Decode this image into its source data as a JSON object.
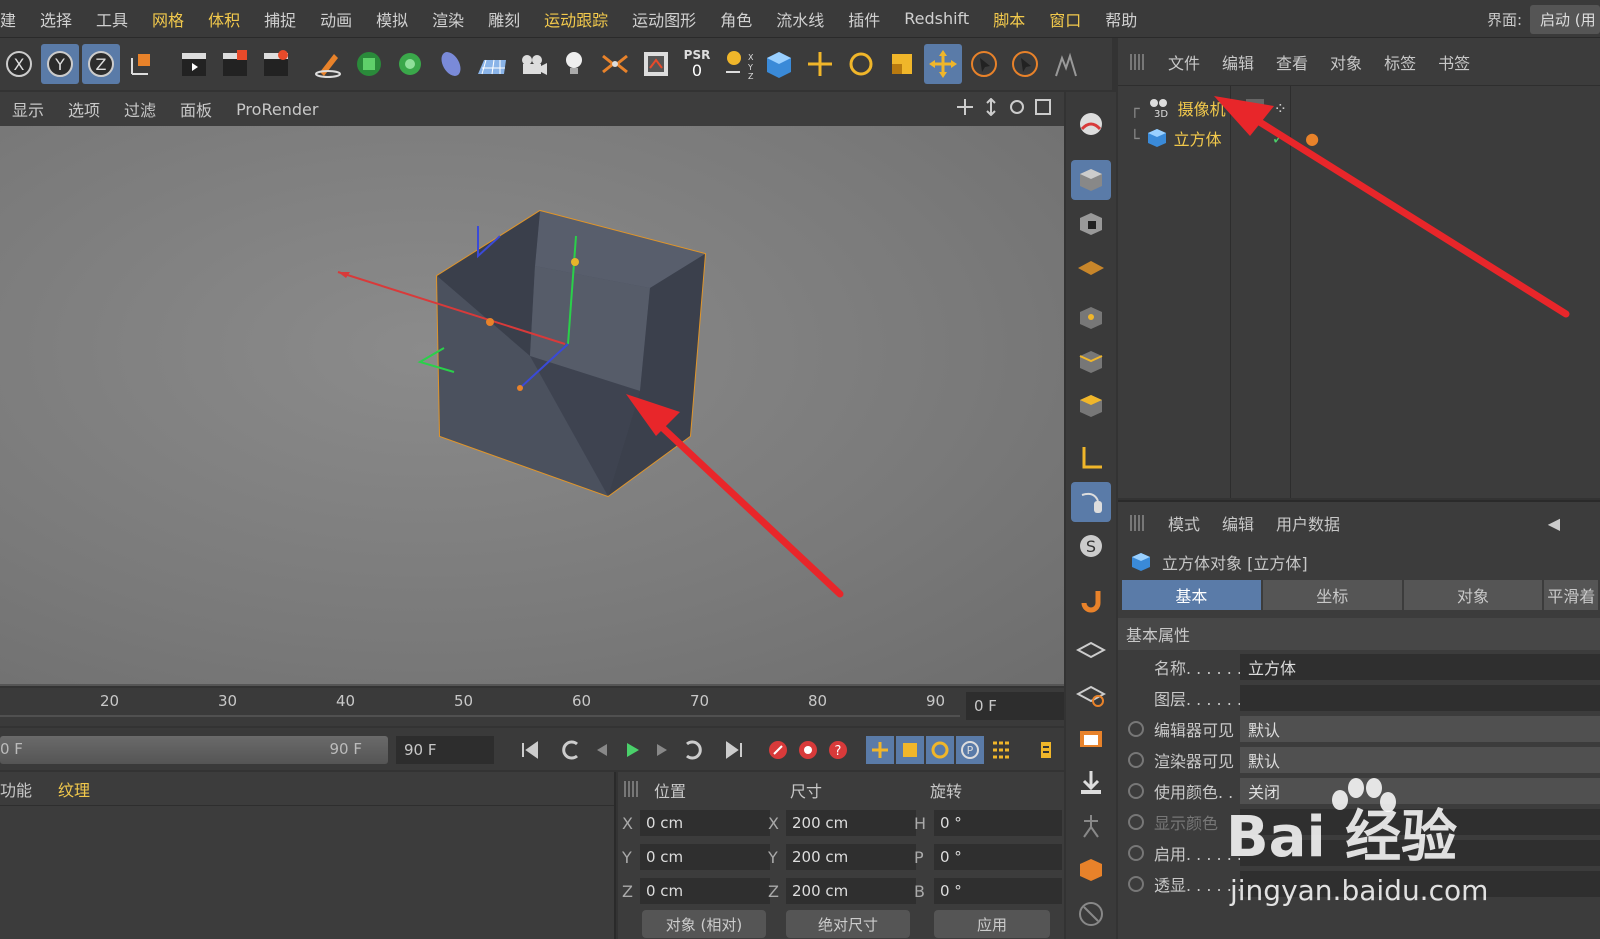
{
  "menubar": {
    "items": [
      {
        "label": "建",
        "hl": false
      },
      {
        "label": "选择",
        "hl": false
      },
      {
        "label": "工具",
        "hl": false
      },
      {
        "label": "网格",
        "hl": true
      },
      {
        "label": "体积",
        "hl": true
      },
      {
        "label": "捕捉",
        "hl": false
      },
      {
        "label": "动画",
        "hl": false
      },
      {
        "label": "模拟",
        "hl": false
      },
      {
        "label": "渲染",
        "hl": false
      },
      {
        "label": "雕刻",
        "hl": false
      },
      {
        "label": "运动跟踪",
        "hl": true
      },
      {
        "label": "运动图形",
        "hl": false
      },
      {
        "label": "角色",
        "hl": false
      },
      {
        "label": "流水线",
        "hl": false
      },
      {
        "label": "插件",
        "hl": false
      },
      {
        "label": "Redshift",
        "hl": false
      },
      {
        "label": "脚本",
        "hl": true
      },
      {
        "label": "窗口",
        "hl": true
      },
      {
        "label": "帮助",
        "hl": false
      }
    ],
    "layout_label": "界面:",
    "layout_value": "启动 (用"
  },
  "toolbar": {
    "psr_label": "PSR",
    "psr_value": "0"
  },
  "viewport_menu": {
    "items": [
      "显示",
      "选项",
      "过滤",
      "面板",
      "ProRender"
    ]
  },
  "object_manager": {
    "menu": [
      "文件",
      "编辑",
      "查看",
      "对象",
      "标签",
      "书签"
    ],
    "objects": [
      {
        "name": "摄像机",
        "icon": "camera-3d-icon"
      },
      {
        "name": "立方体",
        "icon": "cube-icon"
      }
    ]
  },
  "attribute_manager": {
    "menu": [
      "模式",
      "编辑",
      "用户数据"
    ],
    "title": "立方体对象 [立方体]",
    "tabs": [
      "基本",
      "坐标",
      "对象",
      "平滑着"
    ],
    "section": "基本属性",
    "props": [
      {
        "label": "名称. . . . . . .",
        "value": "立方体",
        "radio": false
      },
      {
        "label": "图层. . . . . . .",
        "value": "",
        "radio": false
      },
      {
        "label": "编辑器可见",
        "value": "默认",
        "radio": true
      },
      {
        "label": "渲染器可见",
        "value": "默认",
        "radio": true
      },
      {
        "label": "使用颜色. . .",
        "value": "关闭",
        "radio": true
      },
      {
        "label": "显示颜色",
        "value": "",
        "radio": true
      },
      {
        "label": "启用. . . . . . .",
        "value": "",
        "radio": true
      },
      {
        "label": "透显. . . . . . .",
        "value": "",
        "radio": true
      }
    ]
  },
  "timeline": {
    "ticks": [
      "20",
      "30",
      "40",
      "50",
      "60",
      "70",
      "80",
      "90"
    ],
    "current_frame": "0 F",
    "range_start": "0 F",
    "range_end": "90 F",
    "end_frame": "90 F"
  },
  "material_panel": {
    "menu": [
      "功能",
      "纹理"
    ]
  },
  "coord_panel": {
    "headers": [
      "位置",
      "尺寸",
      "旋转"
    ],
    "rows": [
      {
        "axis": "X",
        "pos": "0 cm",
        "size_axis": "X",
        "size": "200 cm",
        "rot_axis": "H",
        "rot": "0 °"
      },
      {
        "axis": "Y",
        "pos": "0 cm",
        "size_axis": "Y",
        "size": "200 cm",
        "rot_axis": "P",
        "rot": "0 °"
      },
      {
        "axis": "Z",
        "pos": "0 cm",
        "size_axis": "Z",
        "size": "200 cm",
        "rot_axis": "B",
        "rot": "0 °"
      }
    ],
    "mode_select": "对象 (相对)",
    "size_select": "绝对尺寸",
    "apply_label": "应用"
  },
  "watermark": {
    "brand": "Bai 经验",
    "url": "jingyan.baidu.com"
  },
  "colors": {
    "accent": "#5a7ba8",
    "highlight_text": "#f2c94c",
    "arrow": "#e8262a"
  }
}
